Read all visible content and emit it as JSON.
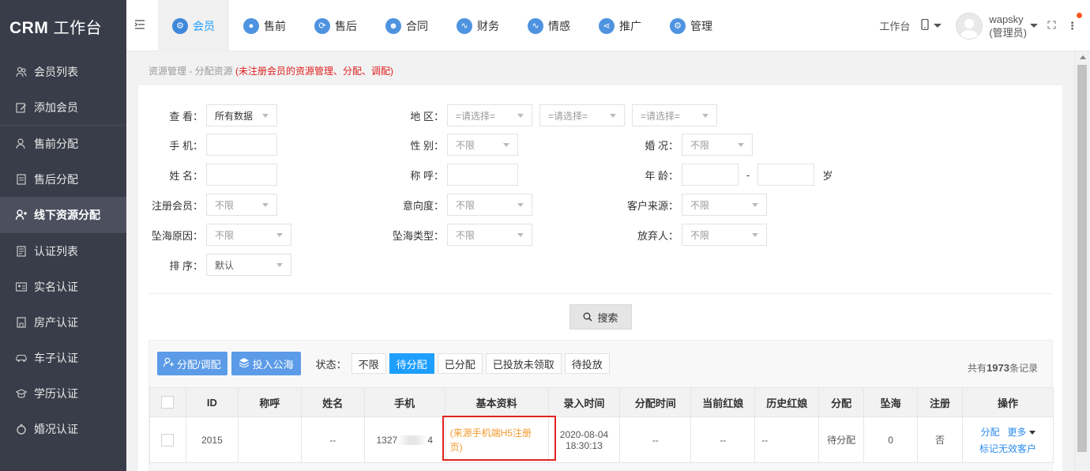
{
  "app": {
    "logo_main": "CRM",
    "logo_sub": "工作台"
  },
  "sidebar": {
    "groups": [
      [
        {
          "label": "会员列表",
          "icon": "users-icon"
        },
        {
          "label": "添加会员",
          "icon": "edit-icon"
        }
      ],
      [
        {
          "label": "售前分配",
          "icon": "user-icon"
        },
        {
          "label": "售后分配",
          "icon": "doc-icon"
        },
        {
          "label": "线下资源分配",
          "icon": "user-plus-icon",
          "active": true
        }
      ],
      [
        {
          "label": "认证列表",
          "icon": "list-icon"
        },
        {
          "label": "实名认证",
          "icon": "id-card-icon"
        },
        {
          "label": "房产认证",
          "icon": "house-icon"
        },
        {
          "label": "车子认证",
          "icon": "car-icon"
        },
        {
          "label": "学历认证",
          "icon": "graduation-icon"
        },
        {
          "label": "婚况认证",
          "icon": "ring-icon"
        }
      ]
    ]
  },
  "nav": {
    "items": [
      {
        "label": "会员",
        "icon": "members-icon",
        "active": true
      },
      {
        "label": "售前",
        "icon": "headset-icon"
      },
      {
        "label": "售后",
        "icon": "service-icon"
      },
      {
        "label": "合同",
        "icon": "contract-icon"
      },
      {
        "label": "财务",
        "icon": "finance-icon"
      },
      {
        "label": "情感",
        "icon": "emotion-icon"
      },
      {
        "label": "推广",
        "icon": "share-icon"
      },
      {
        "label": "管理",
        "icon": "settings-icon"
      }
    ]
  },
  "topright": {
    "workbench": "工作台",
    "username": "wapsky",
    "role": "(管理员)"
  },
  "breadcrumb": {
    "path": "资源管理 - 分配资源",
    "note": "(未注册会员的资源管理、分配、调配)"
  },
  "form": {
    "view_label": "查 看：",
    "view_value": "所有数据",
    "region_label": "地 区：",
    "region_ph1": "=请选择=",
    "region_ph2": "=请选择=",
    "region_ph3": "=请选择=",
    "phone_label": "手 机：",
    "gender_label": "性 别：",
    "gender_value": "不限",
    "marital_label": "婚 况：",
    "marital_value": "不限",
    "name_label": "姓 名：",
    "title_label": "称 呼：",
    "age_label": "年 龄：",
    "age_sep": "-",
    "age_unit": "岁",
    "reg_label": "注册会员：",
    "reg_value": "不限",
    "intent_label": "意向度：",
    "intent_value": "不限",
    "source_label": "客户来源：",
    "source_value": "不限",
    "drop_reason_label": "坠海原因：",
    "drop_reason_value": "不限",
    "drop_type_label": "坠海类型：",
    "drop_type_value": "不限",
    "giver_label": "放弃人：",
    "giver_value": "不限",
    "sort_label": "排 序：",
    "sort_value": "默认",
    "search_label": "搜索"
  },
  "toolbar": {
    "assign_label": "分配/调配",
    "pool_label": "投入公海",
    "status_label": "状态：",
    "tabs": [
      {
        "label": "不限"
      },
      {
        "label": "待分配",
        "active": true
      },
      {
        "label": "已分配"
      },
      {
        "label": "已投放未领取"
      },
      {
        "label": "待投放"
      }
    ],
    "total_prefix": "共有",
    "total_count": "1973",
    "total_suffix": "条记录"
  },
  "table": {
    "headers": [
      "ID",
      "称呼",
      "姓名",
      "手机",
      "基本资料",
      "录入时间",
      "分配时间",
      "当前红娘",
      "历史红娘",
      "分配",
      "坠海",
      "注册",
      "操作"
    ],
    "rows": [
      {
        "id": "2015",
        "title": "",
        "name": "--",
        "phone_prefix": "1327",
        "phone_suffix": "4",
        "basic": "(来源手机端H5注册页)",
        "entry_date": "2020-08-04",
        "entry_time": "18:30:13",
        "assign_time": "--",
        "current_matchmaker": "--",
        "history_matchmaker": "--",
        "assign_status": "待分配",
        "dropped": "0",
        "registered": "否",
        "op_assign": "分配",
        "op_more": "更多",
        "op_mark": "标记无效客户"
      }
    ]
  }
}
